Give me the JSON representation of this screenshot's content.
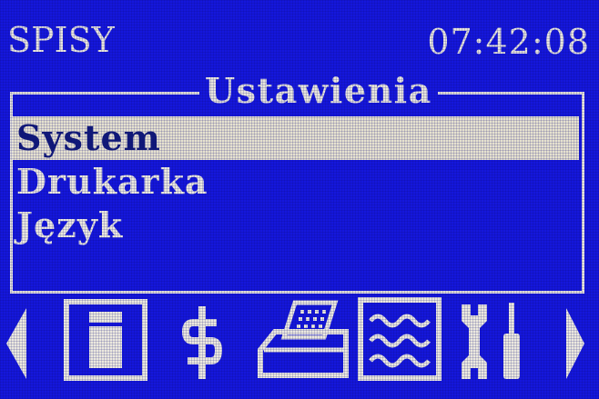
{
  "header": {
    "app_title": "SPISY",
    "time": "07:42:08"
  },
  "menu": {
    "title": "Ustawienia",
    "items": [
      {
        "label": "System",
        "selected": true
      },
      {
        "label": "Drukarka",
        "selected": false
      },
      {
        "label": "Język",
        "selected": false
      }
    ]
  },
  "toolbar": {
    "icons": [
      "arrow-left-icon",
      "document-icon",
      "dollar-icon",
      "printer-icon",
      "report-icon",
      "tools-icon",
      "arrow-right-icon"
    ],
    "selected_icon": "report-icon"
  },
  "colors": {
    "background": "#1517dc",
    "foreground": "#e9e6dd",
    "selection_background": "#e6e2cf",
    "selection_text": "#111a78"
  }
}
